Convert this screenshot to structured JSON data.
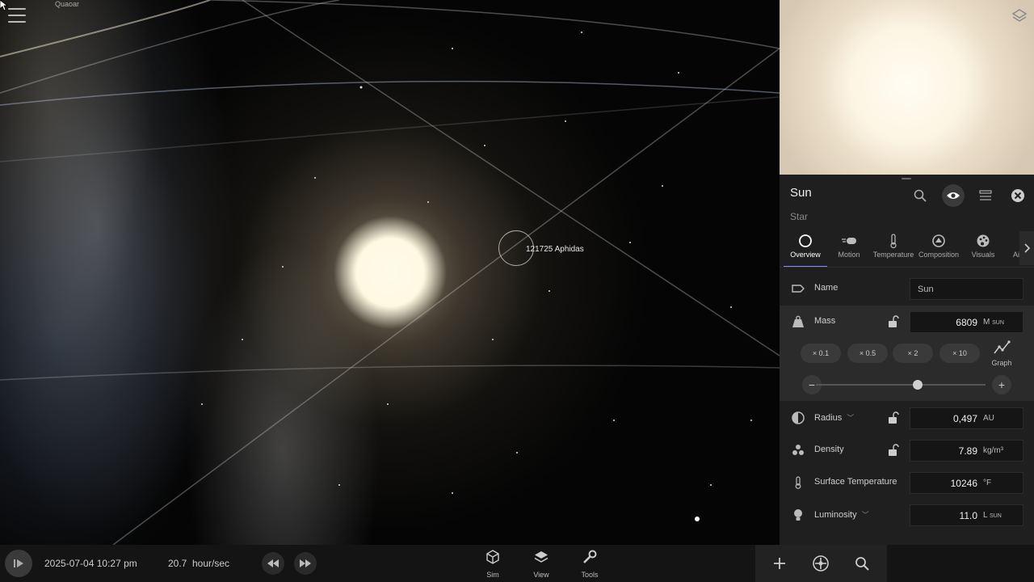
{
  "viewport": {
    "labels": {
      "quaoar": "Quaoar",
      "selected": "121725 Aphidas"
    }
  },
  "object": {
    "name": "Sun",
    "type": "Star"
  },
  "tabs": [
    {
      "label": "Overview",
      "icon": "circle-icon",
      "active": true
    },
    {
      "label": "Motion",
      "icon": "motion-icon",
      "active": false
    },
    {
      "label": "Temperature",
      "icon": "thermometer-icon",
      "active": false
    },
    {
      "label": "Composition",
      "icon": "composition-icon",
      "active": false
    },
    {
      "label": "Visuals",
      "icon": "palette-icon",
      "active": false
    },
    {
      "label": "Ai",
      "icon": "atmosphere-icon",
      "active": false
    }
  ],
  "properties": {
    "name": {
      "label": "Name",
      "value": "Sun"
    },
    "mass": {
      "label": "Mass",
      "value": "6809",
      "unit": "M",
      "unit_sub": "SUN",
      "slider_fraction": 0.6
    },
    "radius": {
      "label": "Radius",
      "value": "0,497",
      "unit": "AU"
    },
    "density": {
      "label": "Density",
      "value": "7.89",
      "unit": "kg/m³"
    },
    "surface_temperature": {
      "label": "Surface Temperature",
      "value": "10246",
      "unit": "°F"
    },
    "luminosity": {
      "label": "Luminosity",
      "value": "11.0",
      "unit": "L",
      "unit_sub": "SUN"
    }
  },
  "multipliers": [
    "× 0.1",
    "× 0.5",
    "× 2",
    "× 10"
  ],
  "graph_label": "Graph",
  "bottombar": {
    "datetime": "2025-07-04 10:27 pm",
    "rate_value": "20.7",
    "rate_unit": "hour/sec",
    "tools": {
      "sim": "Sim",
      "view": "View",
      "tools": "Tools"
    }
  },
  "colors": {
    "panel_bg": "#1f1f1f",
    "accent": "#8a8aff"
  }
}
